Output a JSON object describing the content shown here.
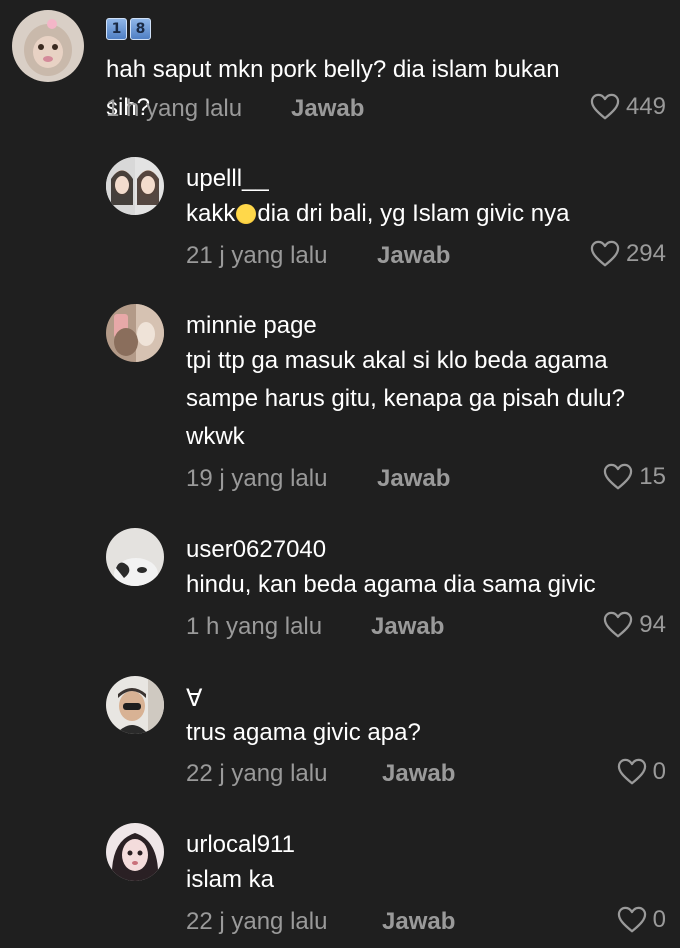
{
  "colors": {
    "background": "#1f1f1f",
    "text": "#ffffff",
    "muted": "#9a9a9a"
  },
  "comments": [
    {
      "badge": [
        "1",
        "8"
      ],
      "text": "hah saput mkn pork belly? dia islam bukan sih?",
      "time": "1 h yang lalu",
      "reply": "Jawab",
      "likes": "449",
      "avatar_icon": "monkey-avatar"
    },
    {
      "username": "upelll__",
      "text_before": "kakk",
      "emoji": "loudly-crying-face-emoji",
      "text_after": "dia dri bali, yg Islam givic nya",
      "time": "21 j yang lalu",
      "reply": "Jawab",
      "likes": "294"
    },
    {
      "username": "minnie page",
      "lines": [
        "tpi ttp ga masuk akal si klo beda agama",
        "sampe harus gitu, kenapa ga pisah dulu?",
        "wkwk"
      ],
      "time": "19 j yang lalu",
      "reply": "Jawab",
      "likes": "15"
    },
    {
      "username": "user0627040",
      "text": "hindu, kan beda agama dia sama givic",
      "time": "1 h yang lalu",
      "reply": "Jawab",
      "likes": "94"
    },
    {
      "username": "∀",
      "text": "trus agama givic apa?",
      "time": "22 j yang lalu",
      "reply": "Jawab",
      "likes": "0"
    },
    {
      "username": "urlocal911",
      "text": "islam ka",
      "time": "22 j yang lalu",
      "reply": "Jawab",
      "likes": "0"
    }
  ]
}
